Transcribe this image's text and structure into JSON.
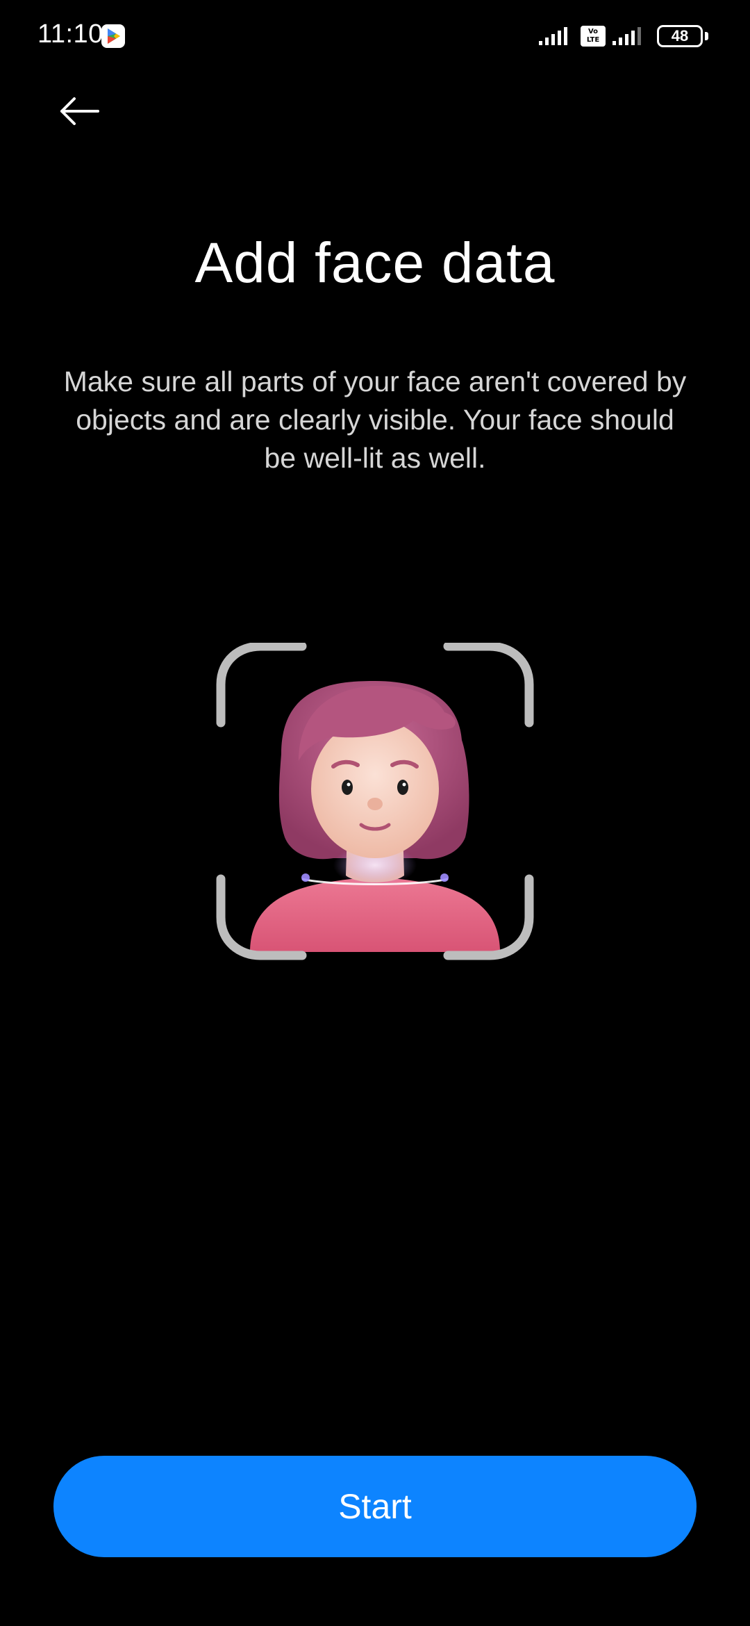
{
  "status_bar": {
    "time": "11:10",
    "volte_label_top": "Vo",
    "volte_label_bottom": "LTE",
    "battery_level": "48",
    "icons": [
      "google-play-icon",
      "signal-icon",
      "volte-icon",
      "signal-icon",
      "battery-icon"
    ]
  },
  "header": {
    "back_icon": "arrow-left-icon"
  },
  "main": {
    "title": "Add face data",
    "description": "Make sure all parts of your face aren't covered by objects and are clearly visible. Your face should be well-lit as well.",
    "illustration": "face-scan-avatar-icon"
  },
  "footer": {
    "start_label": "Start"
  },
  "colors": {
    "background": "#000000",
    "accent": "#0d84ff",
    "text_primary": "#ffffff",
    "text_secondary": "#d6d6d6"
  }
}
